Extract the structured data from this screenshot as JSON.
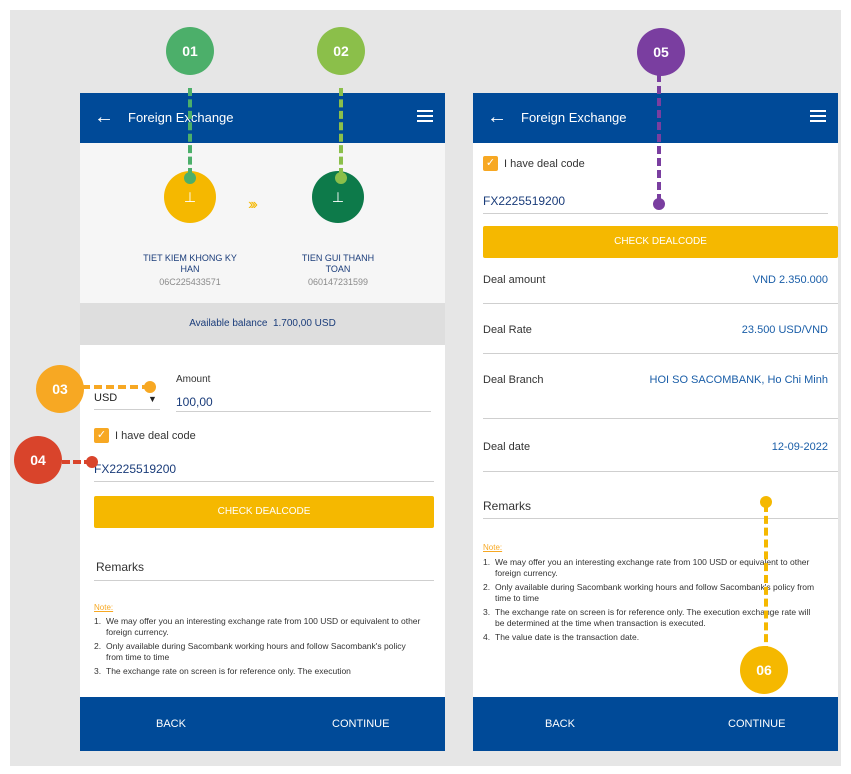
{
  "app_title": "Foreign Exchange",
  "screen1": {
    "from_account": {
      "name_line1": "TIET KIEM KHONG KY",
      "name_line2": "HAN",
      "number": "06C225433571"
    },
    "to_account": {
      "name_line1": "TIEN GUI THANH",
      "name_line2": "TOAN",
      "number": "060147231599"
    },
    "balance_label": "Available balance",
    "balance_value": "1.700,00 USD",
    "currency": "USD",
    "amount_label": "Amount",
    "amount_value": "100,00",
    "deal_checkbox_label": "I have deal code",
    "deal_code": "FX2225519200",
    "check_button": "CHECK DEALCODE",
    "remarks_label": "Remarks",
    "note_label": "Note:",
    "notes": [
      {
        "n": "1.",
        "text": "We may offer you an interesting exchange rate from 100 USD or equivalent to other foreign currency."
      },
      {
        "n": "2.",
        "text": "Only available during Sacombank working hours and follow Sacombank's policy from time to time"
      },
      {
        "n": "3.",
        "text": "The exchange rate on screen is for reference only. The execution"
      }
    ],
    "back": "BACK",
    "continue": "CONTINUE"
  },
  "screen2": {
    "deal_checkbox_label": "I have deal code",
    "deal_code": "FX2225519200",
    "check_button": "CHECK DEALCODE",
    "rows": [
      {
        "label": "Deal amount",
        "value": "VND 2.350.000"
      },
      {
        "label": "Deal Rate",
        "value": "23.500 USD/VND"
      },
      {
        "label": "Deal Branch",
        "value": "HOI SO SACOMBANK, Ho Chi Minh"
      },
      {
        "label": "Deal date",
        "value": "12-09-2022"
      }
    ],
    "remarks_label": "Remarks",
    "note_label": "Note:",
    "notes": [
      {
        "n": "1.",
        "text": "We may offer you an interesting exchange rate from 100 USD or equivalent to other foreign currency."
      },
      {
        "n": "2.",
        "text": "Only available during Sacombank working hours and follow Sacombank's policy from time to time"
      },
      {
        "n": "3.",
        "text": "The exchange rate on screen is for reference only. The execution exchange rate will be determined at the time when transaction is executed."
      },
      {
        "n": "4.",
        "text": "The value date is the transaction date."
      }
    ],
    "back": "BACK",
    "continue": "CONTINUE"
  },
  "callouts": [
    {
      "label": "01",
      "color": "#4caf6a"
    },
    {
      "label": "02",
      "color": "#8bbf4a"
    },
    {
      "label": "03",
      "color": "#f7a823"
    },
    {
      "label": "04",
      "color": "#d9442b"
    },
    {
      "label": "05",
      "color": "#7a3ea0"
    },
    {
      "label": "06",
      "color": "#f5b800"
    }
  ],
  "colors": {
    "primary": "#004a98",
    "accent": "#f5b800",
    "checkbox": "#f7a823"
  }
}
